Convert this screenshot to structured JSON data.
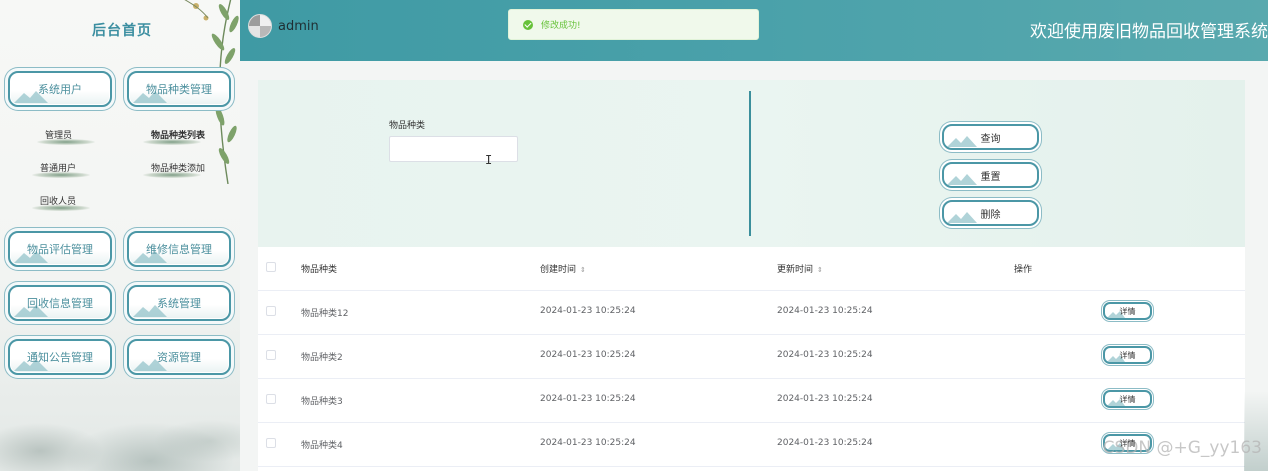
{
  "sidebar": {
    "title": "后台首页",
    "groups": [
      {
        "label": "系统用户"
      },
      {
        "label": "物品种类管理"
      },
      {
        "label": "物品评估管理"
      },
      {
        "label": "维修信息管理"
      },
      {
        "label": "回收信息管理"
      },
      {
        "label": "系统管理"
      },
      {
        "label": "通知公告管理"
      },
      {
        "label": "资源管理"
      }
    ],
    "sub_items": {
      "system_users": [
        "管理员",
        "普通用户",
        "回收人员"
      ],
      "category": [
        "物品种类列表",
        "物品种类添加"
      ]
    }
  },
  "header": {
    "user": "admin",
    "toast": "修改成功!",
    "welcome": "欢迎使用废旧物品回收管理系统"
  },
  "search": {
    "label": "物品种类",
    "value": "",
    "placeholder": "",
    "buttons": {
      "query": "查询",
      "reset": "重置",
      "delete": "删除"
    }
  },
  "table": {
    "headers": [
      "物品种类",
      "创建时间",
      "更新时间",
      "操作"
    ],
    "sort_icon": "⇕",
    "detail_label": "详情",
    "rows": [
      {
        "name": "物品种类12",
        "created": "2024-01-23 10:25:24",
        "updated": "2024-01-23 10:25:24"
      },
      {
        "name": "物品种类2",
        "created": "2024-01-23 10:25:24",
        "updated": "2024-01-23 10:25:24"
      },
      {
        "name": "物品种类3",
        "created": "2024-01-23 10:25:24",
        "updated": "2024-01-23 10:25:24"
      },
      {
        "name": "物品种类4",
        "created": "2024-01-23 10:25:24",
        "updated": "2024-01-23 10:25:24"
      }
    ]
  },
  "watermark": "CSDN @+G_yy163",
  "colors": {
    "accent": "#4b97a6",
    "header": "#4aa1aa",
    "success": "#67c23a"
  }
}
